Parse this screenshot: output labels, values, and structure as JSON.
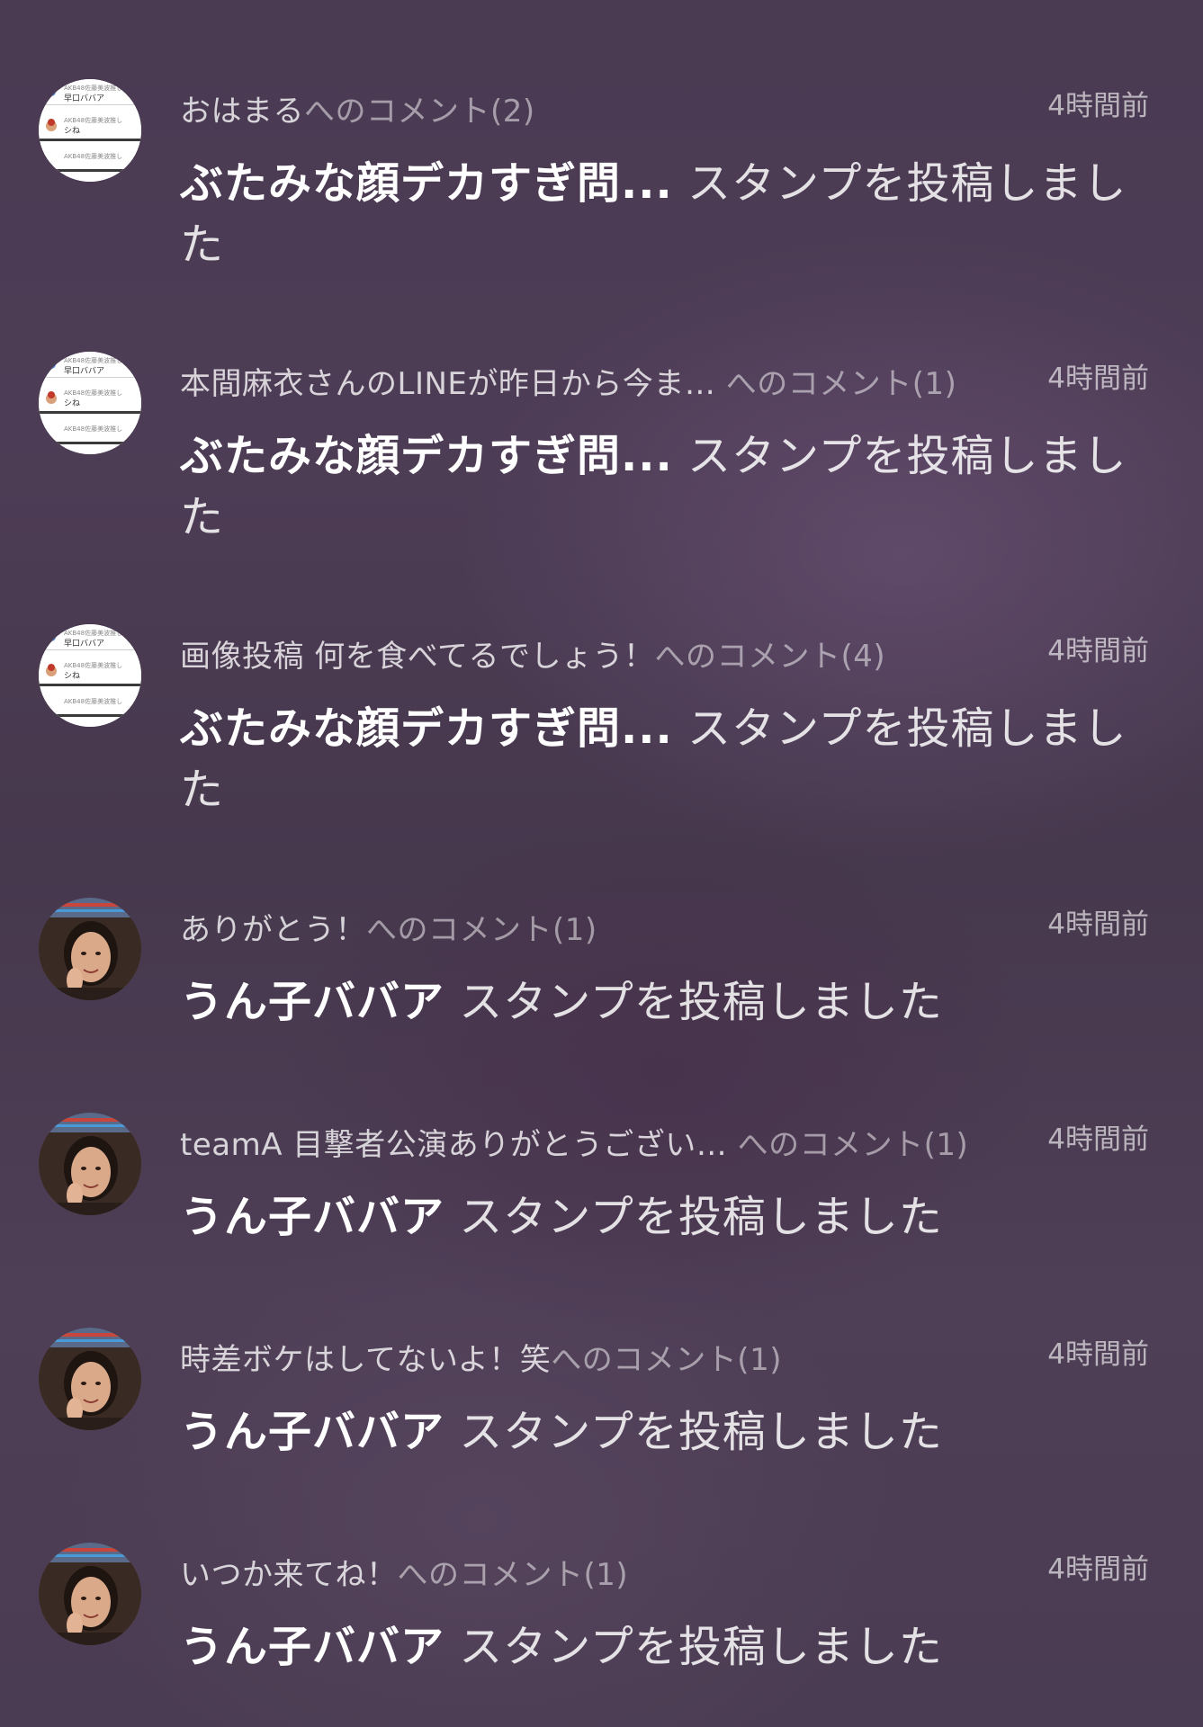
{
  "notifications": [
    {
      "avatar": "sticker-list-avatar",
      "topic": "おはまる",
      "suffix": "へのコメント(2)",
      "time": "4時間前",
      "name": "ぶたみな顔デカすぎ問...",
      "action": " スタンプを投稿しました"
    },
    {
      "avatar": "sticker-list-avatar",
      "topic": "本間麻衣さんのLINEが昨日から今ま… ",
      "suffix": "へのコメント(1)",
      "time": "4時間前",
      "name": "ぶたみな顔デカすぎ問...",
      "action": " スタンプを投稿しました"
    },
    {
      "avatar": "sticker-list-avatar",
      "topic": "画像投稿 何を食べてるでしょう！",
      "suffix": "へのコメント(4)",
      "time": "4時間前",
      "name": "ぶたみな顔デカすぎ問...",
      "action": " スタンプを投稿しました"
    },
    {
      "avatar": "photo-avatar",
      "topic": "ありがとう！",
      "suffix": "へのコメント(1)",
      "time": "4時間前",
      "name": "うん子ババア",
      "action": " スタンプを投稿しました"
    },
    {
      "avatar": "photo-avatar",
      "topic": "teamA 目撃者公演ありがとうござい… ",
      "suffix": "へのコメント(1)",
      "time": "4時間前",
      "name": "うん子ババア",
      "action": " スタンプを投稿しました"
    },
    {
      "avatar": "photo-avatar",
      "topic": "時差ボケはしてないよ！笑",
      "suffix": "へのコメント(1)",
      "time": "4時間前",
      "name": "うん子ババア",
      "action": " スタンプを投稿しました"
    },
    {
      "avatar": "photo-avatar",
      "topic": "いつか来てね！",
      "suffix": "へのコメント(1)",
      "time": "4時間前",
      "name": "うん子ババア",
      "action": " スタンプを投稿しました"
    }
  ],
  "avatar_list_image": {
    "row1": "AKB48佐藤美波推し",
    "row1_name": "早口ババア",
    "row2": "AKB48佐藤美波推し",
    "row2_name": "シね",
    "row3": "AKB48佐藤美波推し"
  }
}
